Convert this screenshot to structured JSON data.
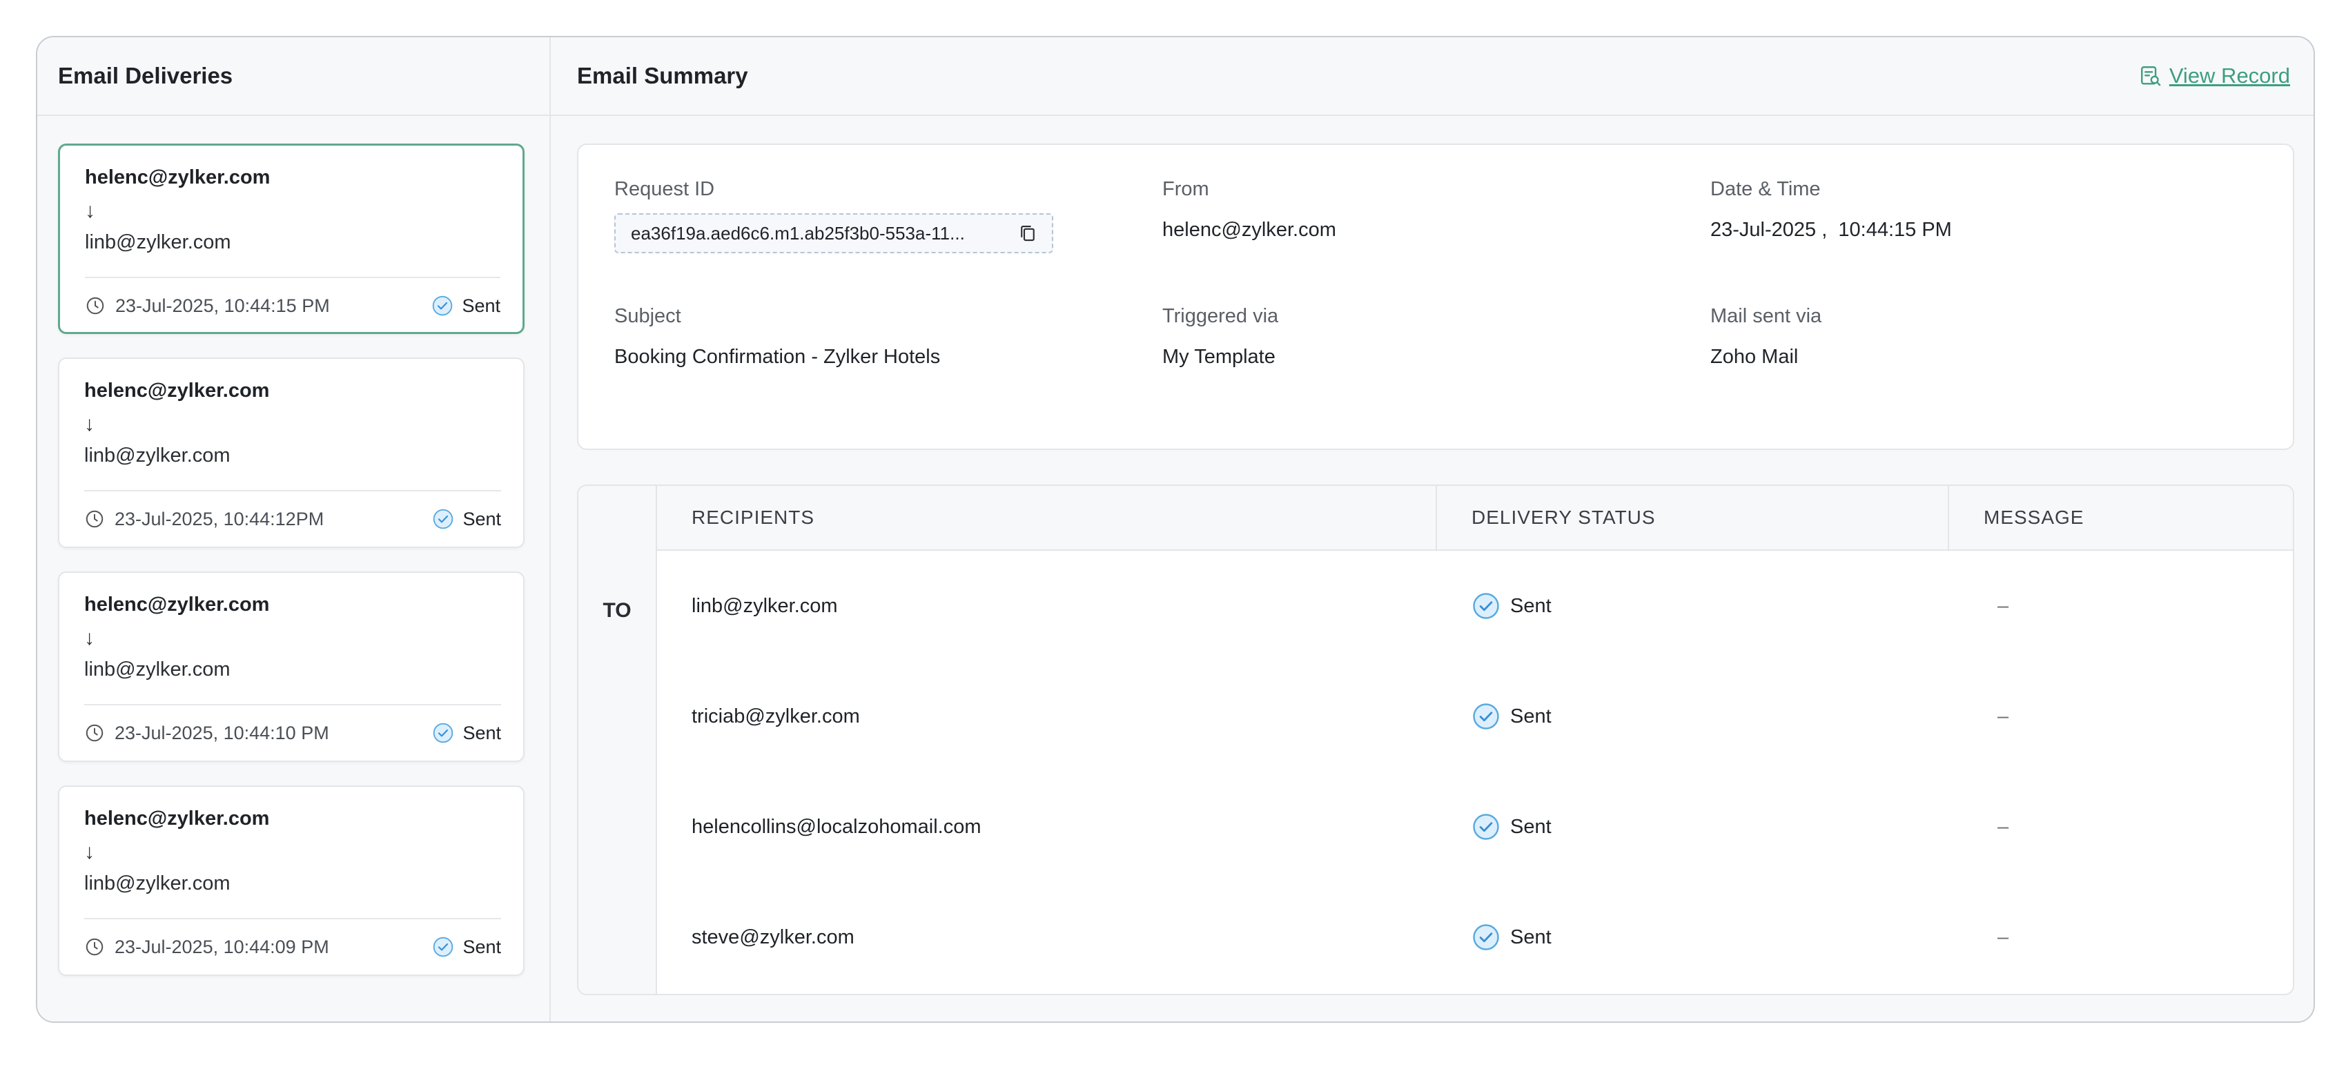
{
  "left": {
    "title": "Email Deliveries",
    "cards": [
      {
        "from": "helenc@zylker.com",
        "arrow": "↓",
        "to": "linb@zylker.com",
        "time": "23-Jul-2025, 10:44:15 PM",
        "status": "Sent",
        "selected": true
      },
      {
        "from": "helenc@zylker.com",
        "arrow": "↓",
        "to": "linb@zylker.com",
        "time": "23-Jul-2025, 10:44:12PM",
        "status": "Sent",
        "selected": false
      },
      {
        "from": "helenc@zylker.com",
        "arrow": "↓",
        "to": "linb@zylker.com",
        "time": "23-Jul-2025, 10:44:10 PM",
        "status": "Sent",
        "selected": false
      },
      {
        "from": "helenc@zylker.com",
        "arrow": "↓",
        "to": "linb@zylker.com",
        "time": "23-Jul-2025, 10:44:09 PM",
        "status": "Sent",
        "selected": false
      }
    ]
  },
  "summary": {
    "title": "Email Summary",
    "view_record": "View Record",
    "request_id_label": "Request ID",
    "request_id": "ea36f19a.aed6c6.m1.ab25f3b0-553a-11...",
    "from_label": "From",
    "from": "helenc@zylker.com",
    "datetime_label": "Date & Time",
    "datetime": "23-Jul-2025 ,  10:44:15 PM",
    "subject_label": "Subject",
    "subject": "Booking Confirmation - Zylker Hotels",
    "triggered_label": "Triggered via",
    "triggered": "My Template",
    "mailvia_label": "Mail sent via",
    "mailvia": "Zoho Mail"
  },
  "table": {
    "type_label": "TO",
    "headers": {
      "recipients": "RECIPIENTS",
      "status": "DELIVERY STATUS",
      "message": "MESSAGE"
    },
    "rows": [
      {
        "recipient": "linb@zylker.com",
        "status": "Sent",
        "message": "–"
      },
      {
        "recipient": "triciab@zylker.com",
        "status": "Sent",
        "message": "–"
      },
      {
        "recipient": "helencollins@localzohomail.com",
        "status": "Sent",
        "message": "–"
      },
      {
        "recipient": "steve@zylker.com",
        "status": "Sent",
        "message": "–"
      }
    ]
  },
  "colors": {
    "accent": "#3d9f7e",
    "sent_check": "#5aa9de",
    "border": "#e3e5e8"
  }
}
